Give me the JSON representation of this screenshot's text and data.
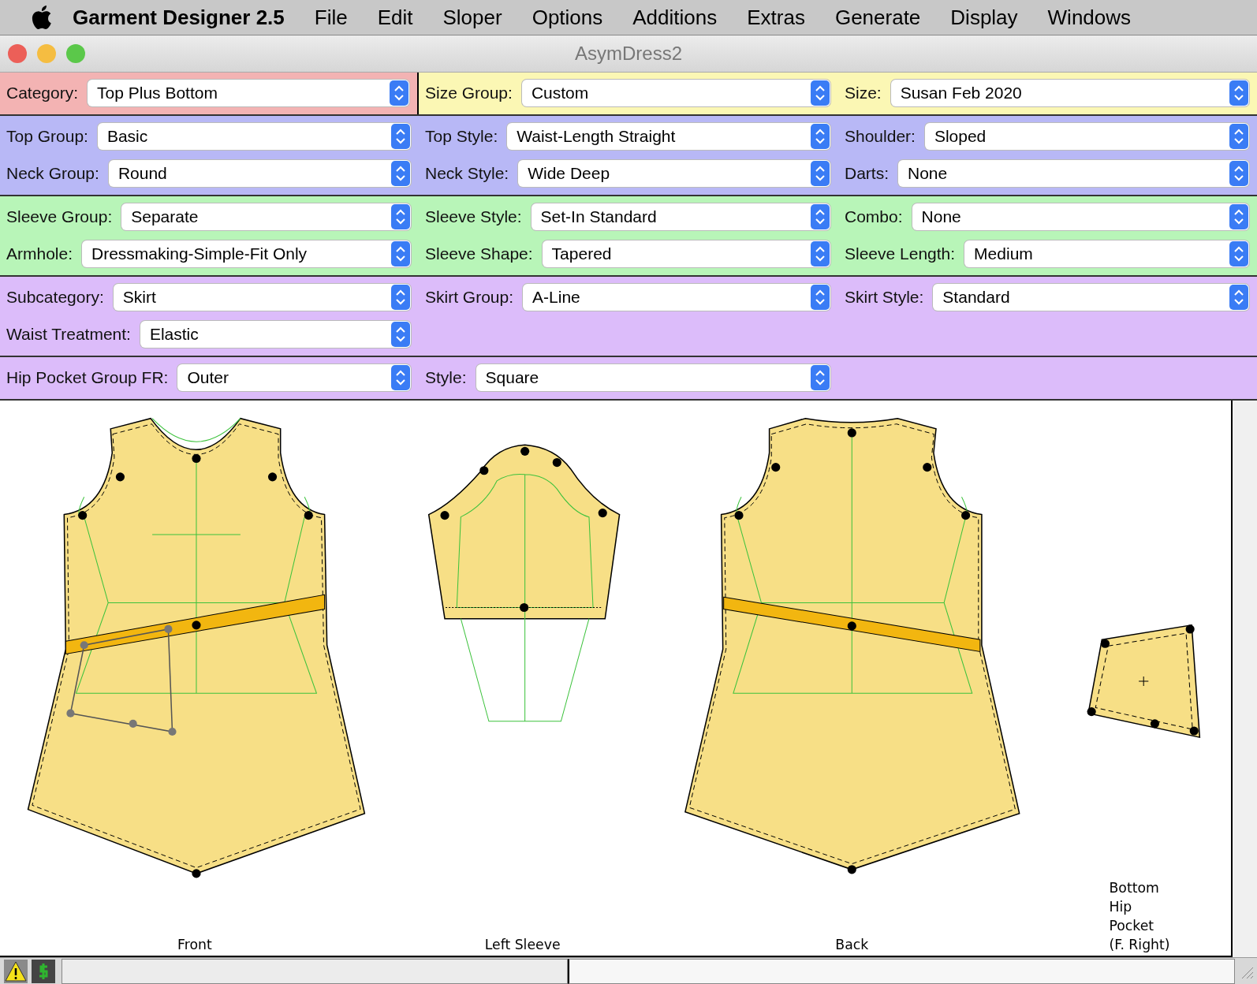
{
  "menu_bar": {
    "app_name": "Garment Designer 2.5",
    "items": [
      "File",
      "Edit",
      "Sloper",
      "Options",
      "Additions",
      "Extras",
      "Generate",
      "Display",
      "Windows"
    ]
  },
  "window": {
    "title": "AsymDress2"
  },
  "bands": [
    {
      "color": "#fbf7b4",
      "rows": [
        [
          {
            "label": "Category:",
            "value": "Top Plus Bottom",
            "color": "#f3b3b3"
          },
          {
            "label": "Size Group:",
            "value": "Custom"
          },
          {
            "label": "Size:",
            "value": "Susan Feb 2020"
          }
        ]
      ]
    },
    {
      "color": "#b8b8f6",
      "rows": [
        [
          {
            "label": "Top Group:",
            "value": "Basic"
          },
          {
            "label": "Top Style:",
            "value": "Waist-Length Straight"
          },
          {
            "label": "Shoulder:",
            "value": "Sloped"
          }
        ],
        [
          {
            "label": "Neck Group:",
            "value": "Round"
          },
          {
            "label": "Neck Style:",
            "value": "Wide Deep"
          },
          {
            "label": "Darts:",
            "value": "None"
          }
        ]
      ]
    },
    {
      "color": "#b8f5b8",
      "rows": [
        [
          {
            "label": "Sleeve Group:",
            "value": "Separate"
          },
          {
            "label": "Sleeve Style:",
            "value": "Set-In Standard"
          },
          {
            "label": "Combo:",
            "value": "None"
          }
        ],
        [
          {
            "label": "Armhole:",
            "value": "Dressmaking-Simple-Fit Only"
          },
          {
            "label": "Sleeve Shape:",
            "value": "Tapered"
          },
          {
            "label": "Sleeve Length:",
            "value": "Medium"
          }
        ]
      ]
    },
    {
      "color": "#dcbcfa",
      "rows": [
        [
          {
            "label": "Subcategory:",
            "value": "Skirt"
          },
          {
            "label": "Skirt Group:",
            "value": "A-Line"
          },
          {
            "label": "Skirt Style:",
            "value": "Standard"
          }
        ],
        [
          {
            "label": "Waist Treatment:",
            "value": "Elastic"
          }
        ]
      ]
    },
    {
      "color": "#dcbcfa",
      "rows": [
        [
          {
            "label": "Hip Pocket Group FR:",
            "value": "Outer"
          },
          {
            "label": "Style:",
            "value": "Square"
          }
        ]
      ]
    }
  ],
  "canvas": {
    "pieces": [
      {
        "kind": "front",
        "label": "Front"
      },
      {
        "kind": "sleeve",
        "label": "Left Sleeve"
      },
      {
        "kind": "back",
        "label": "Back"
      },
      {
        "kind": "pocket",
        "label": "Bottom\nHip\nPocket\n(F. Right)"
      }
    ]
  }
}
